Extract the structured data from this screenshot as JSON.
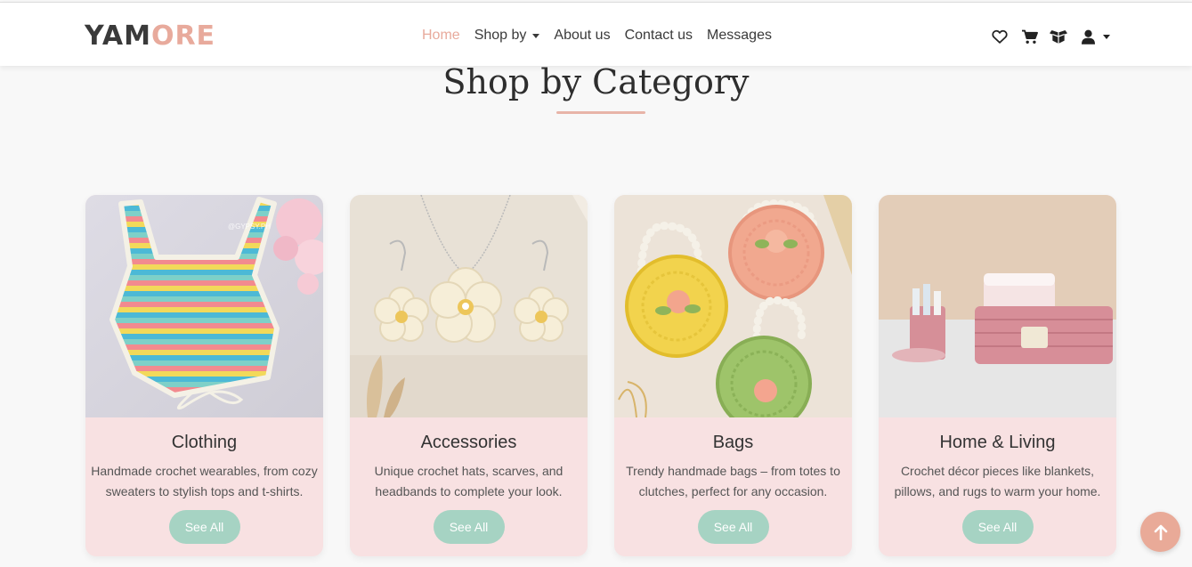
{
  "brand": {
    "logo_part1": "YAM",
    "logo_part2": "ORE",
    "accent": "#e8aa9c"
  },
  "nav": {
    "links": [
      {
        "label": "Home",
        "active": true
      },
      {
        "label": "Shop by",
        "dropdown": true
      },
      {
        "label": "About us"
      },
      {
        "label": "Contact us"
      },
      {
        "label": "Messages"
      }
    ],
    "icons": [
      "heart-icon",
      "cart-icon",
      "box-icon",
      "user-icon"
    ]
  },
  "section": {
    "title": "Shop by Category"
  },
  "categories": [
    {
      "title": "Clothing",
      "desc": "Handmade crochet wearables, from cozy sweaters to stylish tops and t-shirts.",
      "button": "See All",
      "image": "crochet-striped-top"
    },
    {
      "title": "Accessories",
      "desc": "Unique crochet hats, scarves, and headbands to complete your look.",
      "button": "See All",
      "image": "crochet-flower-jewelry"
    },
    {
      "title": "Bags",
      "desc": "Trendy handmade bags – from totes to clutches, perfect for any occasion.",
      "button": "See All",
      "image": "crochet-round-bags"
    },
    {
      "title": "Home & Living",
      "desc": "Crochet décor pieces like blankets, pillows, and rugs to warm your home.",
      "button": "See All",
      "image": "crochet-storage-baskets"
    }
  ],
  "colors": {
    "card_bg": "#f8e1e2",
    "button": "#a6d3c3",
    "back_to_top": "#e9aa98"
  },
  "watermark": "@GYPSY.PH"
}
